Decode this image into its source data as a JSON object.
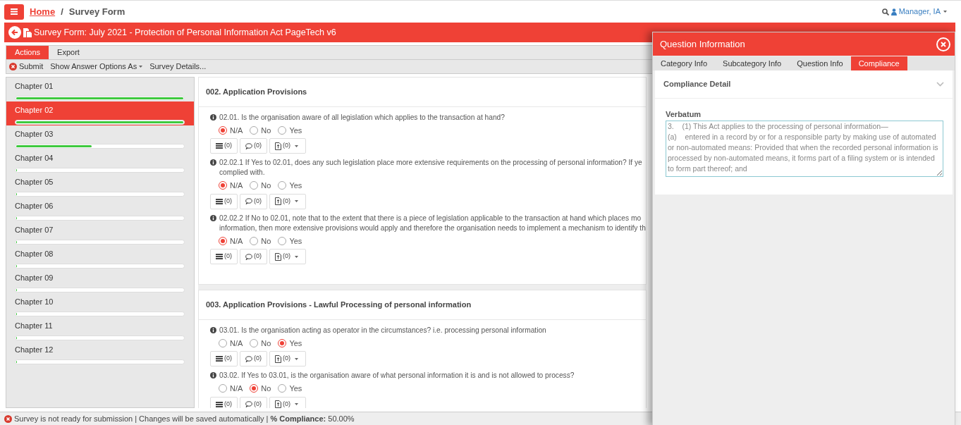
{
  "breadcrumb": {
    "home": "Home",
    "separator": "/",
    "current": "Survey Form"
  },
  "user": {
    "name": "Manager, IA"
  },
  "survey_title": "Survey Form: July 2021 - Protection of Personal Information Act PageTech v6",
  "tabs": [
    {
      "label": "Actions",
      "selected": true
    },
    {
      "label": "Export",
      "selected": false
    }
  ],
  "toolbar": [
    {
      "label": "Submit",
      "kind": "submit"
    },
    {
      "label": "Show Answer Options As",
      "kind": "dropdown"
    },
    {
      "label": "Survey Details...",
      "kind": "plain"
    }
  ],
  "chapters": [
    {
      "label": "Chapter 01",
      "selected": false,
      "level": 1
    },
    {
      "label": "Chapter 02",
      "selected": true,
      "level": 1
    },
    {
      "label": "Chapter 03",
      "selected": false,
      "level": 0.45
    },
    {
      "label": "Chapter 04",
      "selected": false,
      "level": 0
    },
    {
      "label": "Chapter 05",
      "selected": false,
      "level": 0
    },
    {
      "label": "Chapter 06",
      "selected": false,
      "level": 0
    },
    {
      "label": "Chapter 07",
      "selected": false,
      "level": 0
    },
    {
      "label": "Chapter 08",
      "selected": false,
      "level": 0
    },
    {
      "label": "Chapter 09",
      "selected": false,
      "level": 0
    },
    {
      "label": "Chapter 10",
      "selected": false,
      "level": 0
    },
    {
      "label": "Chapter 11",
      "selected": false,
      "level": 0
    },
    {
      "label": "Chapter 12",
      "selected": false,
      "level": 0
    }
  ],
  "sections": [
    {
      "title": "002. Application Provisions",
      "questions": [
        {
          "text": "02.01. Is the organisation aware of all legislation which applies to the transaction at hand?",
          "options": [
            {
              "label": "N/A",
              "selected": true
            },
            {
              "label": "No",
              "selected": false
            },
            {
              "label": "Yes",
              "selected": false
            }
          ],
          "buttons": [
            "(0)",
            "(0)",
            "(0)"
          ]
        },
        {
          "text": "02.02.1 If Yes to 02.01, does any such legislation place more extensive requirements on the processing of personal information? If ye\ncomplied with.",
          "options": [
            {
              "label": "N/A",
              "selected": true
            },
            {
              "label": "No",
              "selected": false
            },
            {
              "label": "Yes",
              "selected": false
            }
          ],
          "buttons": [
            "(0)",
            "(0)",
            "(0)"
          ]
        },
        {
          "text": "02.02.2 If No to 02.01, note that to the extent that there is a piece of legislation applicable to the transaction at hand which places mo\ninformation, then more extensive provisions would apply and therefore the organisation needs to implement a mechanism to identify th",
          "options": [
            {
              "label": "N/A",
              "selected": true
            },
            {
              "label": "No",
              "selected": false
            },
            {
              "label": "Yes",
              "selected": false
            }
          ],
          "buttons": [
            "(0)",
            "(0)",
            "(0)"
          ]
        }
      ]
    },
    {
      "title": "003. Application Provisions - Lawful Processing of personal information",
      "questions": [
        {
          "text": "03.01. Is the organisation acting as operator in the circumstances? i.e. processing personal information",
          "options": [
            {
              "label": "N/A",
              "selected": false
            },
            {
              "label": "No",
              "selected": false
            },
            {
              "label": "Yes",
              "selected": true
            }
          ],
          "buttons": [
            "(0)",
            "(0)",
            "(0)"
          ]
        },
        {
          "text": "03.02. If Yes to 03.01, is the organisation aware of what personal information it is and is not allowed to process?",
          "options": [
            {
              "label": "N/A",
              "selected": false
            },
            {
              "label": "No",
              "selected": true
            },
            {
              "label": "Yes",
              "selected": false
            }
          ],
          "buttons": [
            "(0)",
            "(0)",
            "(0)"
          ]
        }
      ]
    }
  ],
  "status_bar": "Survey is not ready for submission | Changes will be saved automatically | **% Compliance:** 50.00%",
  "panel": {
    "title": "Question Information",
    "tabs": [
      {
        "label": "Category Info",
        "selected": false
      },
      {
        "label": "Subcategory Info",
        "selected": false
      },
      {
        "label": "Question Info",
        "selected": false
      },
      {
        "label": "Compliance",
        "selected": true
      }
    ],
    "section": "Compliance Detail",
    "field_label": "Verbatum",
    "field_value": "3.    (1) This Act applies to the processing of personal information—\n(a)    entered in a record by or for a responsible party by making use of automated or non-automated means: Provided that when the recorded personal information is processed by non-automated means, it forms part of a filing system or is intended to form part thereof; and"
  }
}
